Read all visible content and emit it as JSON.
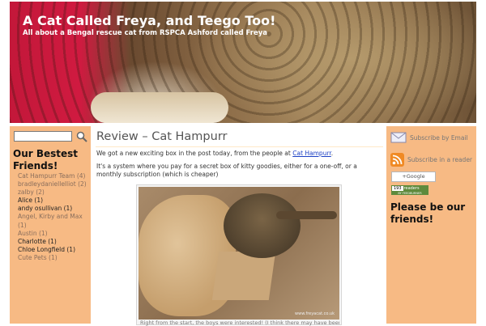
{
  "header": {
    "title": "A Cat Called Freya, and Teego Too!",
    "description": "All about a Bengal rescue cat from RSPCA Ashford called Freya"
  },
  "left_sidebar": {
    "search": {
      "value": ""
    },
    "heading": "Our Bestest Friends!",
    "friends": [
      {
        "label": "Cat Hampurr Team (4)"
      },
      {
        "label": "bradleydaniellelliot (2)"
      },
      {
        "label": "zalby (2)"
      },
      {
        "label": "Alice (1)"
      },
      {
        "label": "andy osullivan (1)"
      },
      {
        "label": "Angel, Kirby and Max (1)"
      },
      {
        "label": "Austin (1)"
      },
      {
        "label": "Charlotte (1)"
      },
      {
        "label": "Chloe Longfield (1)"
      },
      {
        "label": "Cute Pets (1)"
      }
    ]
  },
  "post": {
    "title": "Review – Cat Hampurr",
    "intro_prefix": "We got a new exciting box in the post today, from the people at ",
    "intro_link": "Cat Hampurr",
    "intro_suffix": ".",
    "paragraph2": "It's a system where you pay for a secret box of kitty goodies, either for a one-off, or a monthly subscription (which is cheaper)",
    "photo_watermark": "www.freyacat.co.uk",
    "photo_caption": "Right from the start, the boys were interested! (I think there may have been a"
  },
  "right_sidebar": {
    "subscribe_email": "Subscribe by Email",
    "subscribe_reader": "Subscribe in a reader",
    "google_button": "+Google",
    "readers_count": "193",
    "readers_label": "readers",
    "readers_sub": "BY FEEDBURNER",
    "heading": "Please be our friends!"
  },
  "colors": {
    "sidebar_bg": "#f7ba84",
    "link": "#1a3fc4",
    "title_text": "#ffffff"
  }
}
